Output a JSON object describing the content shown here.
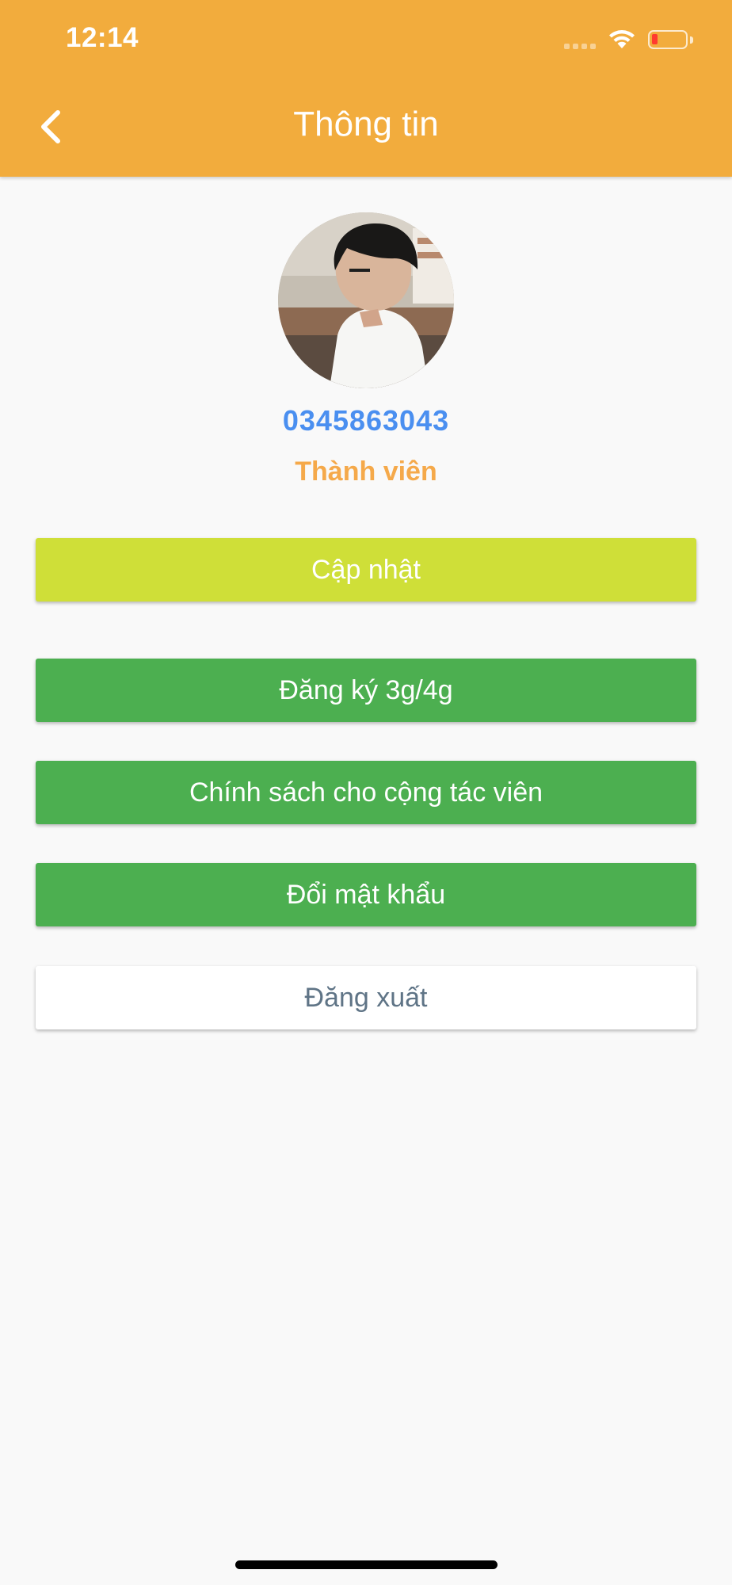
{
  "status_bar": {
    "time": "12:14"
  },
  "header": {
    "title": "Thông tin",
    "background_color": "#f2ac3d"
  },
  "profile": {
    "phone": "0345863043",
    "role": "Thành viên",
    "phone_color": "#4a8ff0",
    "role_color": "#f5a94a"
  },
  "buttons": {
    "update": "Cập nhật",
    "register": "Đăng ký 3g/4g",
    "policy": "Chính sách cho cộng tác viên",
    "change_password": "Đổi mật khẩu",
    "logout": "Đăng xuất"
  },
  "icons": {
    "back": "chevron-left-icon",
    "wifi": "wifi-icon",
    "battery": "battery-low-icon",
    "signal": "signal-icon"
  },
  "colors": {
    "update_button": "#cfdf38",
    "primary_green": "#4caf50",
    "logout_text": "#5f7486",
    "page_background": "#f9f9f9"
  }
}
